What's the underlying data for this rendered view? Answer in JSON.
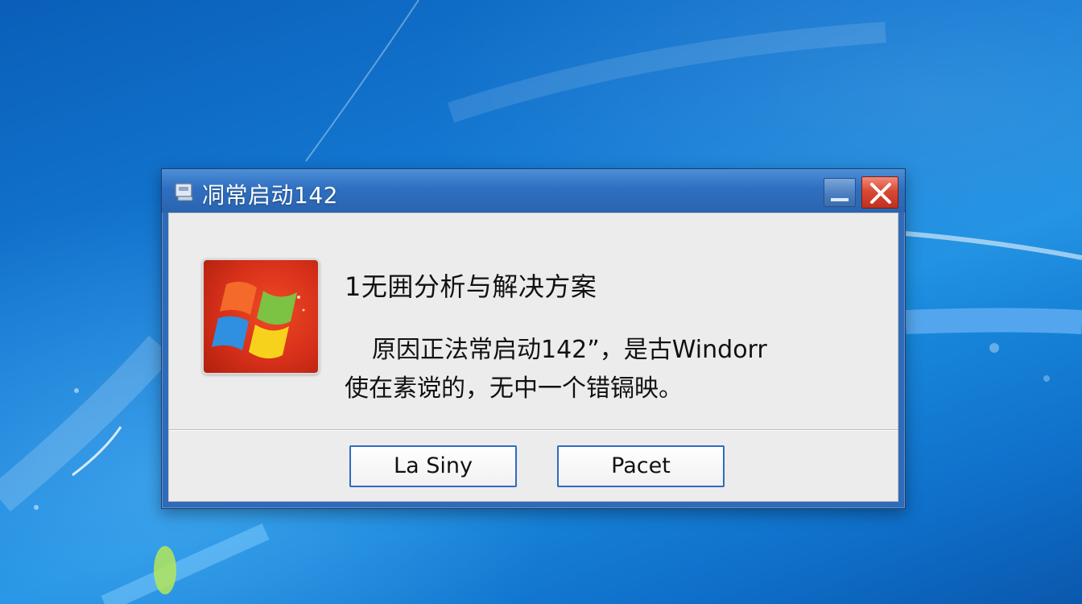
{
  "dialog": {
    "title": "㓊常启动142",
    "heading": "1无囲分析与解决方案",
    "message_line1": "原因正法常启动142”，是古Windorr",
    "message_line2": "使在素谠的，无中一个错镉映。",
    "buttons": {
      "left_label": "La Siny",
      "right_label": "Pacet"
    },
    "icons": {
      "title_icon": "system-icon",
      "logo": "windows-logo-icon",
      "minimize": "minimize-icon",
      "close": "close-icon"
    }
  },
  "colors": {
    "desktop_blue": "#1479d3",
    "titlebar_blue": "#2f6fc0",
    "close_red": "#d94a35",
    "client_bg": "#ececec",
    "button_border": "#2e6cc0"
  }
}
